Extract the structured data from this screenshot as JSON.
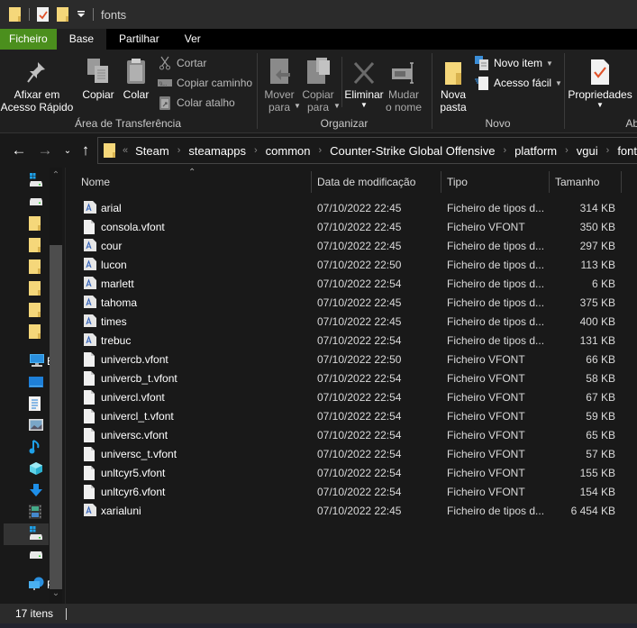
{
  "window": {
    "title": "fonts",
    "quick_access_icons": [
      "folder-icon",
      "properties-icon",
      "new-folder-icon",
      "customize-toolbar-icon"
    ]
  },
  "ribbon_tabs": [
    {
      "label": "Ficheiro",
      "state": "file"
    },
    {
      "label": "Base",
      "state": "active"
    },
    {
      "label": "Partilhar",
      "state": ""
    },
    {
      "label": "Ver",
      "state": ""
    }
  ],
  "ribbon": {
    "clipboard": {
      "group_label": "Área de Transferência",
      "pin": "Afixar em\nAcesso Rápido",
      "copy": "Copiar",
      "paste": "Colar",
      "cut": "Cortar",
      "copy_path": "Copiar caminho",
      "paste_shortcut": "Colar atalho"
    },
    "organize": {
      "group_label": "Organizar",
      "move_to": "Mover\npara",
      "copy_to": "Copiar\npara",
      "delete": "Eliminar",
      "rename": "Mudar\no nome"
    },
    "new": {
      "group_label": "Novo",
      "new_folder": "Nova\npasta",
      "new_item": "Novo item",
      "easy_access": "Acesso fácil"
    },
    "open": {
      "group_label": "Abr",
      "properties": "Propriedades"
    }
  },
  "address": {
    "overflow": "«",
    "crumbs": [
      "Steam",
      "steamapps",
      "common",
      "Counter-Strike Global Offensive",
      "platform",
      "vgui",
      "fonts"
    ]
  },
  "nav_pane": {
    "items": [
      {
        "icon": "system-drive-icon",
        "label": ""
      },
      {
        "icon": "drive-icon",
        "label": ""
      },
      {
        "icon": "folder-icon",
        "label": ""
      },
      {
        "icon": "folder-icon",
        "label": ""
      },
      {
        "icon": "folder-icon",
        "label": ""
      },
      {
        "icon": "folder-icon",
        "label": ""
      },
      {
        "icon": "folder-icon",
        "label": ""
      },
      {
        "icon": "folder-icon",
        "label": ""
      },
      {
        "icon": "this-pc-icon",
        "label": "E"
      },
      {
        "icon": "desktop-icon",
        "label": ""
      },
      {
        "icon": "documents-icon",
        "label": ""
      },
      {
        "icon": "pictures-icon",
        "label": ""
      },
      {
        "icon": "music-icon",
        "label": ""
      },
      {
        "icon": "3d-objects-icon",
        "label": ""
      },
      {
        "icon": "downloads-icon",
        "label": ""
      },
      {
        "icon": "videos-icon",
        "label": ""
      },
      {
        "icon": "system-drive-icon",
        "label": "",
        "selected": true
      },
      {
        "icon": "drive-icon",
        "label": ""
      },
      {
        "icon": "network-icon",
        "label": "R"
      }
    ]
  },
  "columns": {
    "name": "Nome",
    "date": "Data de modificação",
    "type": "Tipo",
    "size": "Tamanho"
  },
  "files": [
    {
      "name": "arial",
      "date": "07/10/2022 22:45",
      "type": "Ficheiro de tipos d...",
      "size": "314 KB",
      "icon": "font-file-icon"
    },
    {
      "name": "consola.vfont",
      "date": "07/10/2022 22:45",
      "type": "Ficheiro VFONT",
      "size": "350 KB",
      "icon": "file-icon"
    },
    {
      "name": "cour",
      "date": "07/10/2022 22:45",
      "type": "Ficheiro de tipos d...",
      "size": "297 KB",
      "icon": "font-file-icon"
    },
    {
      "name": "lucon",
      "date": "07/10/2022 22:50",
      "type": "Ficheiro de tipos d...",
      "size": "113 KB",
      "icon": "font-file-icon"
    },
    {
      "name": "marlett",
      "date": "07/10/2022 22:54",
      "type": "Ficheiro de tipos d...",
      "size": "6 KB",
      "icon": "font-file-icon"
    },
    {
      "name": "tahoma",
      "date": "07/10/2022 22:45",
      "type": "Ficheiro de tipos d...",
      "size": "375 KB",
      "icon": "font-file-icon"
    },
    {
      "name": "times",
      "date": "07/10/2022 22:45",
      "type": "Ficheiro de tipos d...",
      "size": "400 KB",
      "icon": "font-file-icon"
    },
    {
      "name": "trebuc",
      "date": "07/10/2022 22:54",
      "type": "Ficheiro de tipos d...",
      "size": "131 KB",
      "icon": "font-file-icon"
    },
    {
      "name": "univercb.vfont",
      "date": "07/10/2022 22:50",
      "type": "Ficheiro VFONT",
      "size": "66 KB",
      "icon": "file-icon"
    },
    {
      "name": "univercb_t.vfont",
      "date": "07/10/2022 22:54",
      "type": "Ficheiro VFONT",
      "size": "58 KB",
      "icon": "file-icon"
    },
    {
      "name": "univercl.vfont",
      "date": "07/10/2022 22:54",
      "type": "Ficheiro VFONT",
      "size": "67 KB",
      "icon": "file-icon"
    },
    {
      "name": "univercl_t.vfont",
      "date": "07/10/2022 22:54",
      "type": "Ficheiro VFONT",
      "size": "59 KB",
      "icon": "file-icon"
    },
    {
      "name": "universc.vfont",
      "date": "07/10/2022 22:54",
      "type": "Ficheiro VFONT",
      "size": "65 KB",
      "icon": "file-icon"
    },
    {
      "name": "universc_t.vfont",
      "date": "07/10/2022 22:54",
      "type": "Ficheiro VFONT",
      "size": "57 KB",
      "icon": "file-icon"
    },
    {
      "name": "unltcyr5.vfont",
      "date": "07/10/2022 22:54",
      "type": "Ficheiro VFONT",
      "size": "155 KB",
      "icon": "file-icon"
    },
    {
      "name": "unltcyr6.vfont",
      "date": "07/10/2022 22:54",
      "type": "Ficheiro VFONT",
      "size": "154 KB",
      "icon": "file-icon"
    },
    {
      "name": "xarialuni",
      "date": "07/10/2022 22:45",
      "type": "Ficheiro de tipos d...",
      "size": "6 454 KB",
      "icon": "font-file-icon"
    }
  ],
  "status": {
    "item_count": "17 itens"
  },
  "colors": {
    "file_tab": "#4b8f1d",
    "folder": "#f5d77a",
    "accent_blue": "#1e90e8"
  }
}
